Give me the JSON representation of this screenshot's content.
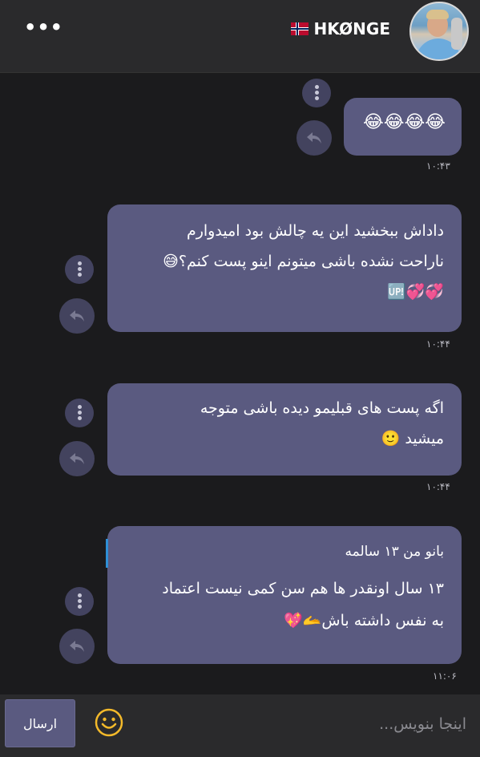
{
  "header": {
    "more_label": "•••",
    "contact_name": "HKØNGE",
    "flag_icon": "norway-flag-icon",
    "avatar_icon": "profile-avatar"
  },
  "messages": [
    {
      "text_lines": [
        "😂😂😂😂"
      ],
      "time": "۱۰:۴۳"
    },
    {
      "text_lines": [
        "داداش ببخشید این یه چالش بود امیدوارم",
        "ناراحت نشده باشی میتونم اینو پست کنم؟😅",
        "💞💞🆙"
      ],
      "time": "۱۰:۴۴"
    },
    {
      "text_lines": [
        "اگه پست های قبلیمو دیده باشی متوجه",
        "میشید 🙂"
      ],
      "time": "۱۰:۴۴"
    },
    {
      "quote": "بانو من ۱۳ سالمه",
      "text_lines": [
        "۱۳ سال اونقدر ها هم سن کمی نیست اعتماد",
        "به نفس داشته باش🫴💖"
      ],
      "time": "۱۱:۰۶"
    }
  ],
  "composer": {
    "send_label": "ارسال",
    "placeholder": "اینجا بنویس...",
    "emoji_icon": "smiley-icon"
  },
  "colors": {
    "background": "#1b1b1d",
    "header": "#2a2a2c",
    "bubble": "#5a5a80",
    "action_circle": "#43435e",
    "quote_bar": "#2e8fd6"
  }
}
